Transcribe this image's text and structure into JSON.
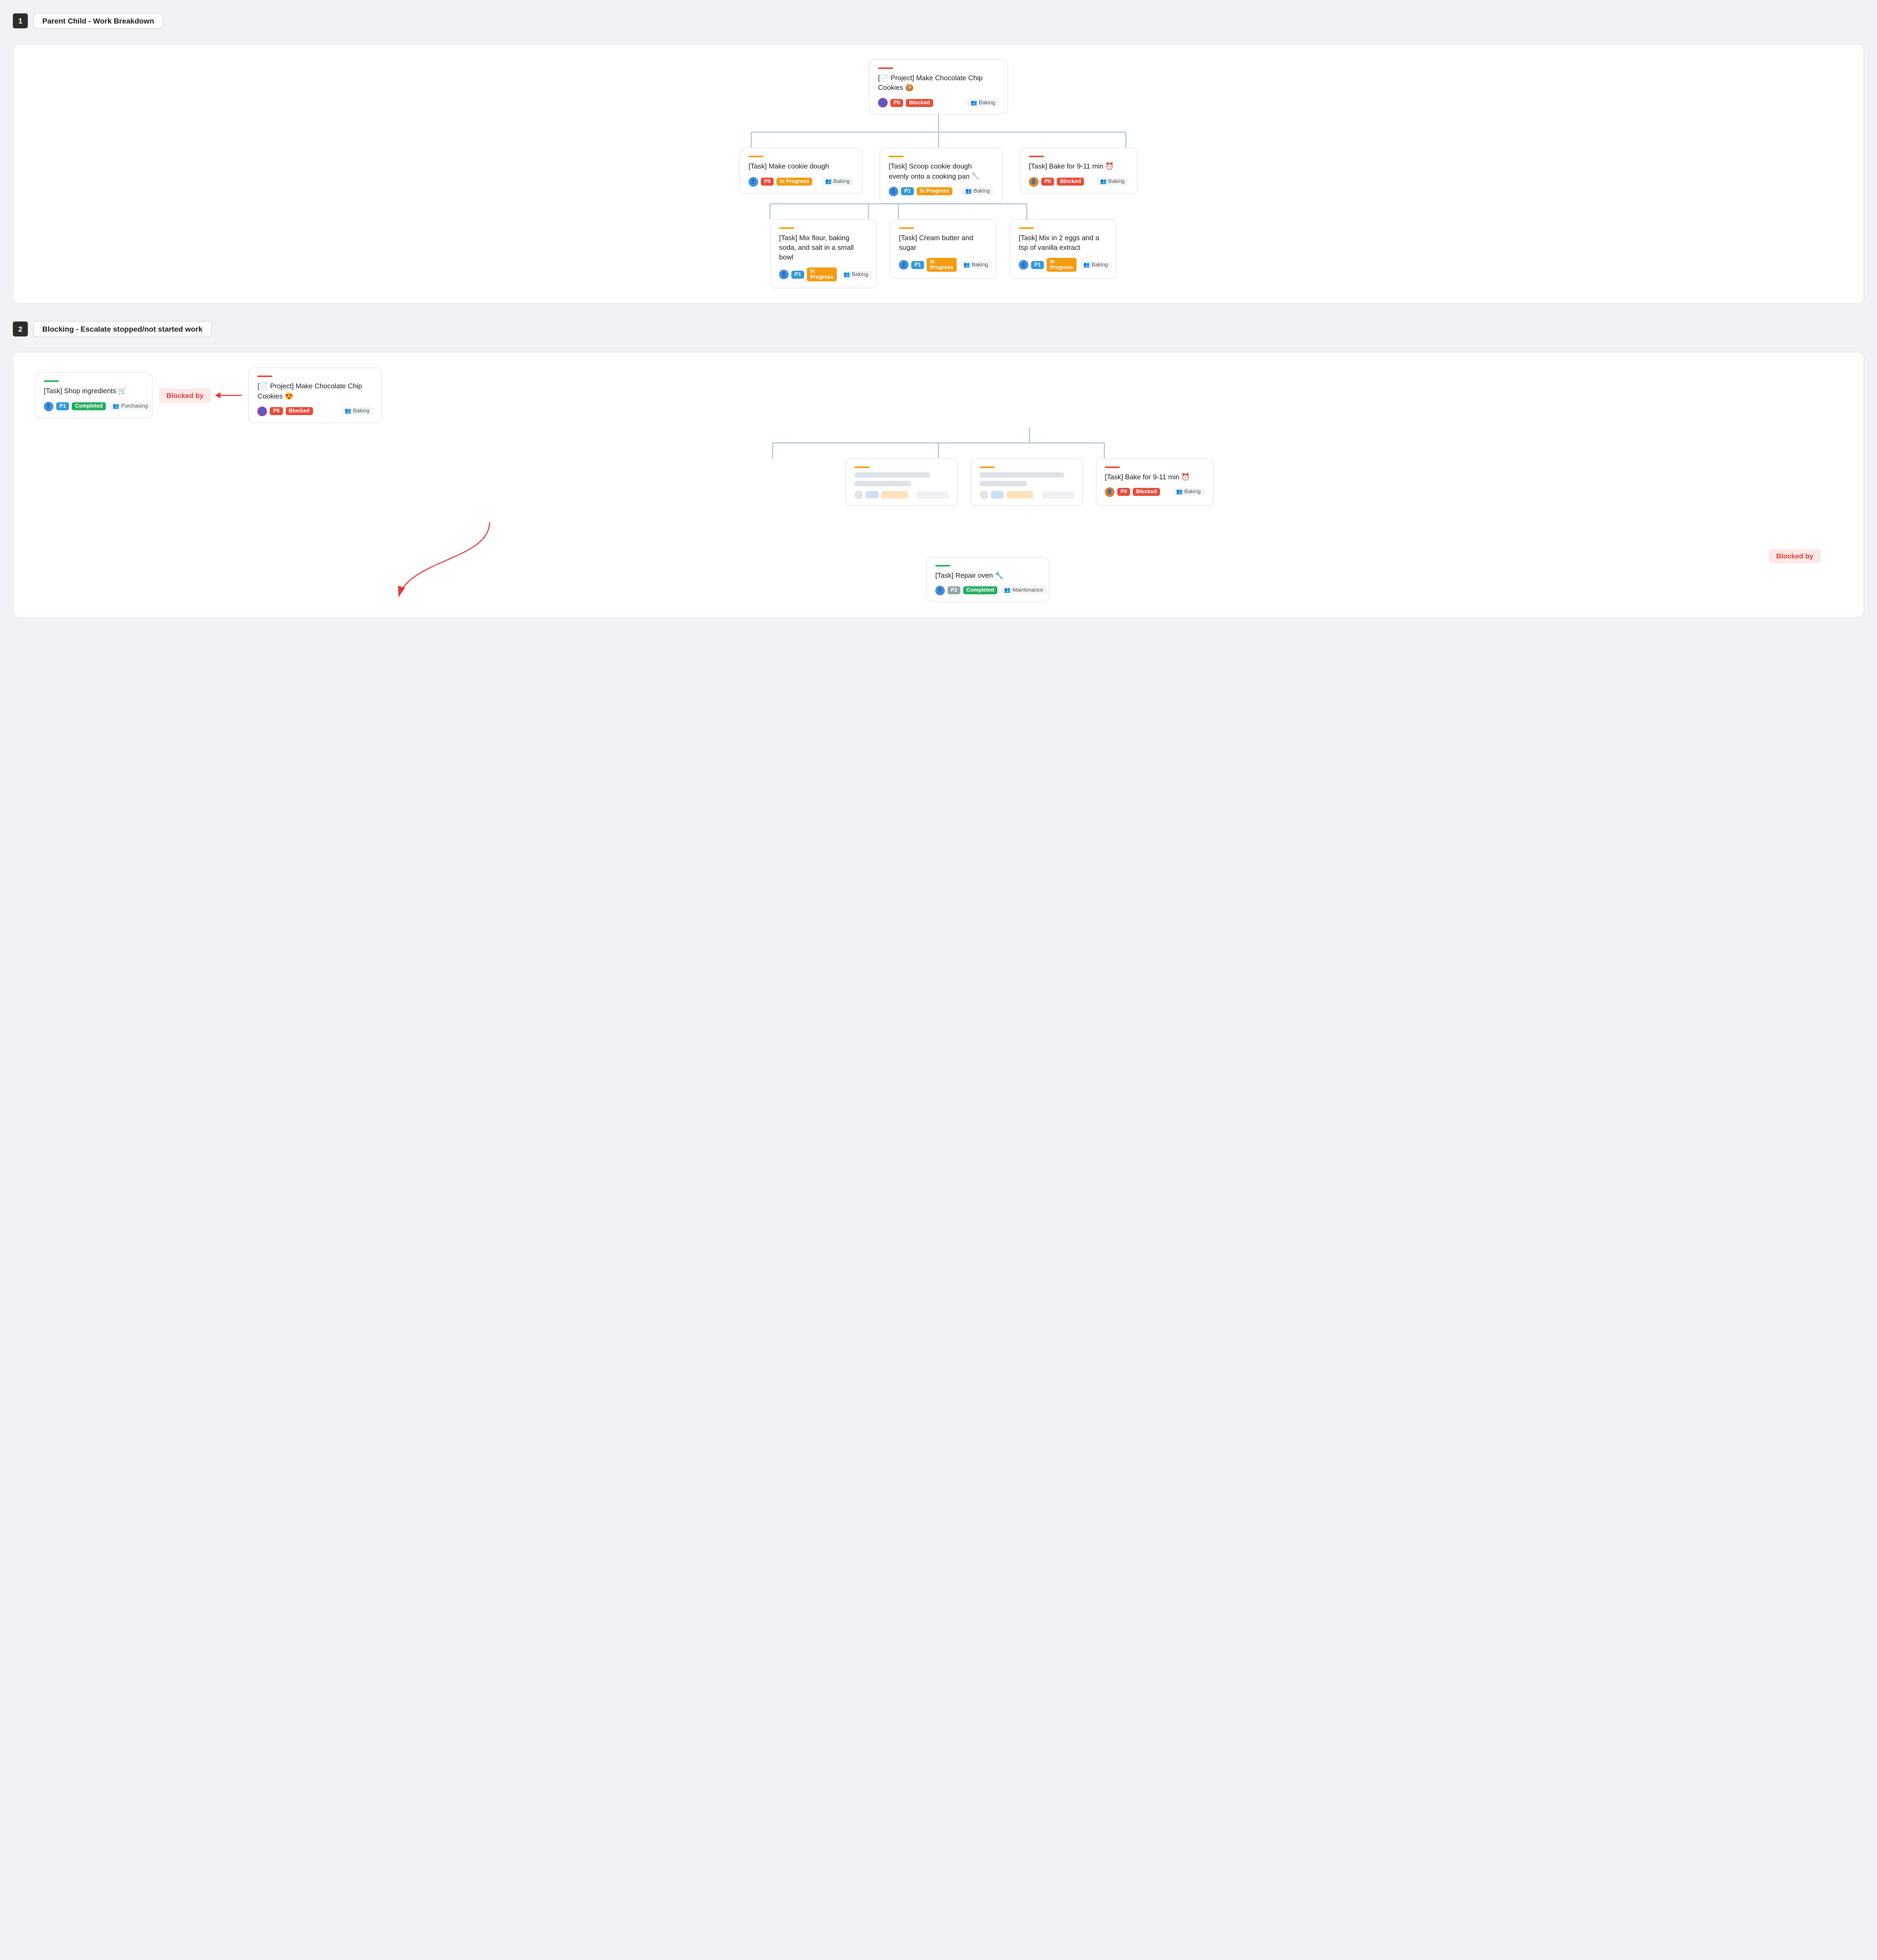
{
  "sections": [
    {
      "number": "1",
      "title": "Parent Child - Work Breakdown",
      "diagram": {
        "root": {
          "accent": "#e74c3c",
          "title": "[📄 Project] Make Chocolate Chip Cookies 🍪",
          "avatar": "👤",
          "priority": "P0",
          "status": "Blocked",
          "status_class": "badge-blocked",
          "team": "Baking"
        },
        "level2": [
          {
            "accent": "#f39c12",
            "title": "[Task] Make cookie dough",
            "priority": "P0",
            "status": "In Progress",
            "status_class": "badge-inprogress",
            "team": "Baking",
            "has_children": true
          },
          {
            "accent": "#f39c12",
            "title": "[Task] Scoop cookie dough evenly onto a cooking pan 🥄",
            "priority": "P1",
            "status": "In Progress",
            "status_class": "badge-inprogress",
            "team": "Baking",
            "has_children": false
          },
          {
            "accent": "#e74c3c",
            "title": "[Task] Bake for 9-11 min ⏰",
            "priority": "P0",
            "status": "Blocked",
            "status_class": "badge-blocked",
            "team": "Baking",
            "has_children": false
          }
        ],
        "level3": [
          {
            "accent": "#f39c12",
            "title": "[Task] Mix flour, baking soda, and salt in a small bowl",
            "priority": "P1",
            "status": "In Progress",
            "status_class": "badge-inprogress",
            "team": "Baking"
          },
          {
            "accent": "#f39c12",
            "title": "[Task] Cream butter and sugar",
            "priority": "P1",
            "status": "In Progress",
            "status_class": "badge-inprogress",
            "team": "Baking"
          },
          {
            "accent": "#f39c12",
            "title": "[Task] Mix in 2 eggs and a tsp of vanilla extract",
            "priority": "P1",
            "status": "In Progress",
            "status_class": "badge-inprogress",
            "team": "Baking"
          }
        ]
      }
    },
    {
      "number": "2",
      "title": "Blocking - Escalate stopped/not started work",
      "diagram": {
        "blocked_task": {
          "accent": "#27ae60",
          "title": "[Task] Shop ingredients 🛒",
          "priority": "P1",
          "status": "Completed",
          "status_class": "badge-completed",
          "team": "Purchasing"
        },
        "blocked_by_label": "Blocked by",
        "root": {
          "accent": "#e74c3c",
          "title": "[📄 Project] Make Chocolate Chip Cookies 😍",
          "priority": "P0",
          "status": "Blocked",
          "status_class": "badge-blocked",
          "team": "Baking"
        },
        "level2_blurred": [
          {
            "accent": "#f39c12"
          },
          {
            "accent": "#f39c12"
          }
        ],
        "bake_task": {
          "accent": "#e74c3c",
          "title": "[Task] Bake for 9-11 min ⏰",
          "priority": "P0",
          "status": "Blocked",
          "status_class": "badge-blocked",
          "team": "Baking"
        },
        "blocked_by_label2": "Blocked by",
        "repair_task": {
          "accent": "#27ae60",
          "title": "[Task] Repair oven 🔧",
          "priority": "P2",
          "status": "Completed",
          "status_class": "badge-completed",
          "team": "Maintenance"
        }
      }
    }
  ]
}
